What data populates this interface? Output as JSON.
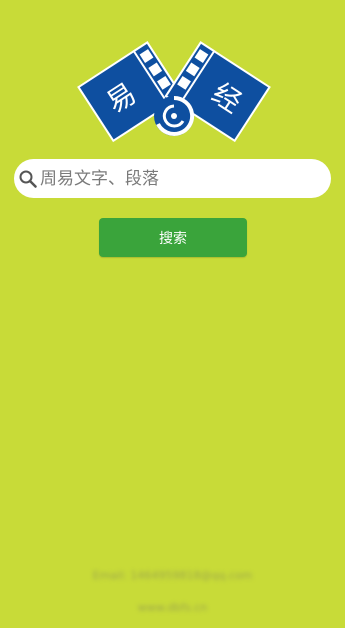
{
  "logo": {
    "left_text": "易",
    "right_text": "经"
  },
  "search": {
    "placeholder": "周易文字、段落",
    "value": ""
  },
  "search_button": {
    "label": "搜索"
  },
  "footer": {
    "line1": "Email: 1464959818@qq.com",
    "line2": "www.dbfs.cn"
  },
  "colors": {
    "background": "#c8db38",
    "logo_blue": "#0e4fa0",
    "button_green": "#3aa43b"
  }
}
